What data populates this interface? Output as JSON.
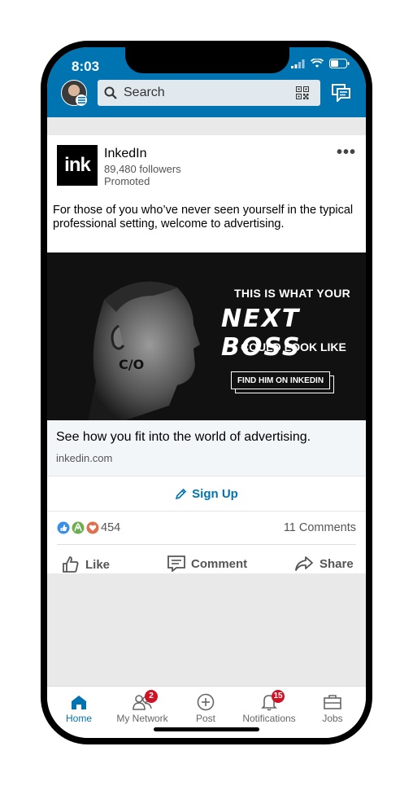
{
  "status_bar": {
    "time": "8:03"
  },
  "search": {
    "placeholder": "Search"
  },
  "icons": {
    "search": "search-icon",
    "qr": "qr-code-icon",
    "messaging": "messaging-icon",
    "more": "more-options-icon",
    "pencil": "pencil-icon",
    "like": "thumbs-up-icon",
    "comment": "comment-icon",
    "share": "share-icon"
  },
  "colors": {
    "brand": "#0073b1",
    "badge": "#d11124"
  },
  "post": {
    "company": "InkedIn",
    "logo_text": "ink",
    "followers": "89,480 followers",
    "promoted": "Promoted",
    "more_label": "•••",
    "text": "For those of you who’ve never seen yourself in the typical professional setting, welcome to advertising.",
    "banner": {
      "line1": "THIS IS WHAT YOUR",
      "line2": "NEXT BOSS",
      "line3": "COULD LOOK LIKE",
      "cta": "FIND HIM ON INKEDIN",
      "tattoo": "C/O"
    },
    "link_title": "See how you fit into the world of advertising.",
    "link_domain": "inkedin.com",
    "signup_label": "Sign Up",
    "reaction_count": "454",
    "comments_count": "11 Comments",
    "actions": {
      "like": "Like",
      "comment": "Comment",
      "share": "Share"
    }
  },
  "tabs": [
    {
      "label": "Home",
      "icon": "home-icon",
      "active": true
    },
    {
      "label": "My Network",
      "icon": "network-icon",
      "badge": "2"
    },
    {
      "label": "Post",
      "icon": "post-icon"
    },
    {
      "label": "Notifications",
      "icon": "bell-icon",
      "badge": "15"
    },
    {
      "label": "Jobs",
      "icon": "briefcase-icon"
    }
  ]
}
